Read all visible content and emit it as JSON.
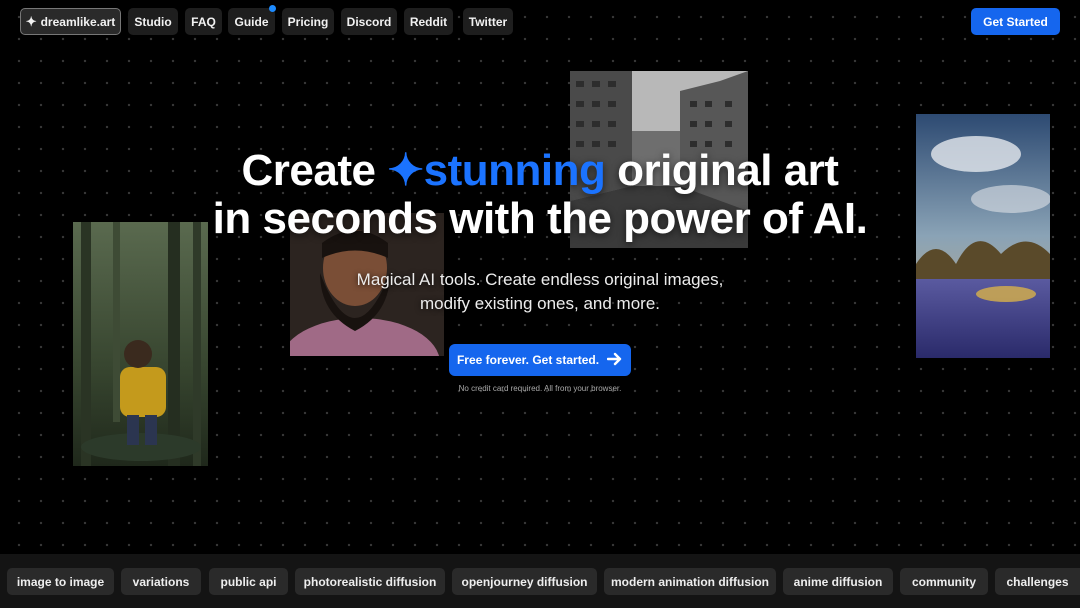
{
  "nav": {
    "logo_label": "dreamlike.art",
    "items": [
      "Studio",
      "FAQ",
      "Guide",
      "Pricing",
      "Discord",
      "Reddit",
      "Twitter"
    ],
    "get_started": "Get Started"
  },
  "hero": {
    "title_part1": "Create",
    "title_highlight": "stunning",
    "title_part2": "original art",
    "title_line2": "in seconds with the power of AI.",
    "subtitle_line1": "Magical AI tools. Create endless original images,",
    "subtitle_line2": "modify existing ones, and more.",
    "cta_label": "Free forever. Get started.",
    "note": "No credit card required. All from your browser."
  },
  "tags": [
    "image to image",
    "variations",
    "public api",
    "photorealistic diffusion",
    "openjourney diffusion",
    "modern animation diffusion",
    "anime diffusion",
    "community",
    "challenges"
  ],
  "colors": {
    "accent": "#1566ee",
    "highlight": "#1b73ff",
    "background": "#000000"
  },
  "icons": {
    "logo": "sparkle-icon",
    "highlight": "sparkle-icon",
    "cta": "arrow-right-icon"
  }
}
